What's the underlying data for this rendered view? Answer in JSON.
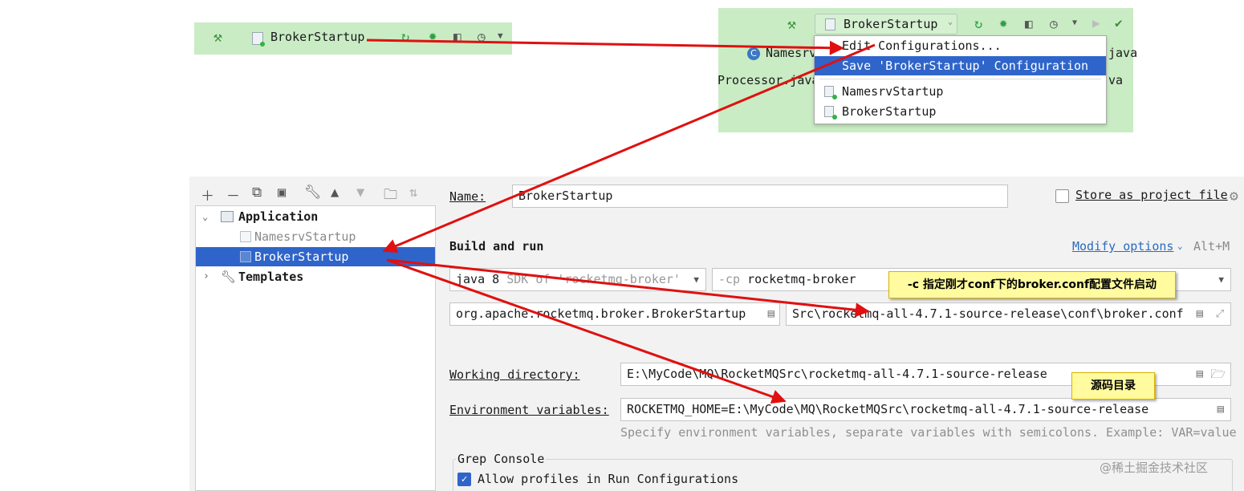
{
  "toolbar_left": {
    "config_name": "BrokerStartup"
  },
  "toolbar_right": {
    "config_name": "BrokerStartup",
    "bg_tab_1": "Namesrv",
    "bg_tab_2": "Processor.java",
    "bg_suffix_1": "java",
    "bg_suffix_2": "va",
    "bg_class_badge": "C",
    "menu": [
      {
        "label": "Edit Configurations..."
      },
      {
        "label": "Save 'BrokerStartup' Configuration"
      },
      {
        "label": "NamesrvStartup"
      },
      {
        "label": "BrokerStartup"
      }
    ]
  },
  "tree": {
    "group_label": "Application",
    "items": [
      {
        "label": "NamesrvStartup"
      },
      {
        "label": "BrokerStartup"
      }
    ],
    "templates_label": "Templates"
  },
  "form": {
    "name_label": "Name:",
    "name_value": "BrokerStartup",
    "store_label": "Store as project file",
    "build_run_label": "Build and run",
    "modify_options": "Modify options",
    "modify_shortcut": "Alt+M",
    "sdk_value": "java 8",
    "sdk_hint": "SDK of 'rocketmq-broker'",
    "cp_prefix": "-cp",
    "cp_value": "rocketmq-broker",
    "main_class": "org.apache.rocketmq.broker.BrokerStartup",
    "program_args": "Src\\rocketmq-all-4.7.1-source-release\\conf\\broker.conf",
    "working_dir_label": "Working directory:",
    "working_dir_value": "E:\\MyCode\\MQ\\RocketMQSrc\\rocketmq-all-4.7.1-source-release",
    "env_label": "Environment variables:",
    "env_value": "ROCKETMQ_HOME=E:\\MyCode\\MQ\\RocketMQSrc\\rocketmq-all-4.7.1-source-release",
    "env_hint": "Specify environment variables, separate variables with semicolons. Example: VAR=value",
    "grep_console_label": "Grep Console",
    "allow_profiles_label": "Allow profiles in Run Configurations"
  },
  "annotations": {
    "note_conf": "-c 指定刚才conf下的broker.conf配置文件启动",
    "note_src": "源码目录"
  },
  "watermark": "@稀土掘金技术社区",
  "colors": {
    "toolbar_green": "#c9ecc4",
    "selection_blue": "#2f65ca",
    "note_yellow": "#fffb9e",
    "arrow_red": "#e01010",
    "link_blue": "#2a6bbf"
  }
}
